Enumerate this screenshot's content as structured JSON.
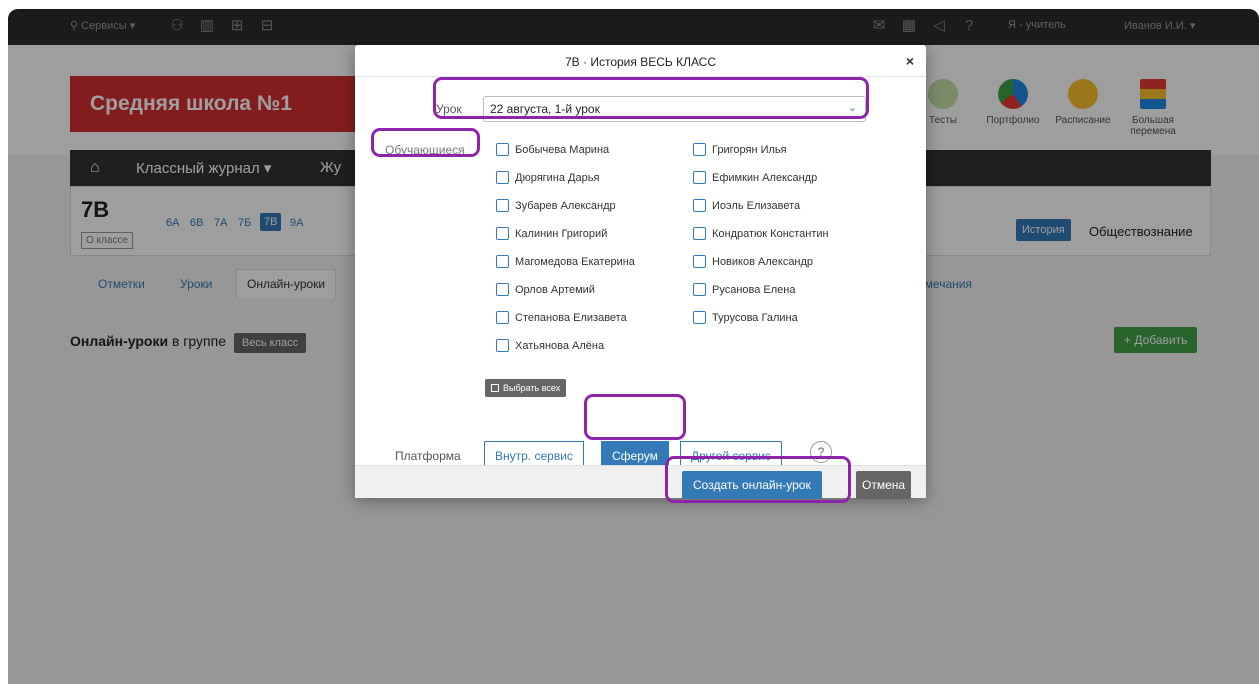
{
  "topbar": {
    "services": "Сервисы",
    "user_role": "Я - учитель",
    "user_name": "Иванов И.И."
  },
  "header": {
    "school_name": "Средняя школа №1",
    "icons": [
      {
        "label": "Тесты",
        "color": "#7cb342"
      },
      {
        "label": "Портфолио",
        "color": "#1e88e5"
      },
      {
        "label": "Расписание",
        "color": "#fbc02d"
      },
      {
        "label": "Большая перемена",
        "color": "#e53935"
      }
    ]
  },
  "journal": {
    "title": "Классный журнал",
    "title2": "Жу"
  },
  "classrow": {
    "current_class": "7В",
    "about": "О классе",
    "classes": [
      "6А",
      "6В",
      "7А",
      "7Б",
      "7В",
      "9А"
    ],
    "subject_button": "История",
    "subject_other": "Обществознание"
  },
  "tabs": [
    "Отметки",
    "Уроки",
    "Онлайн-уроки",
    "амечания"
  ],
  "online": {
    "title": "Онлайн-уроки",
    "in_group": "в группе",
    "group_badge": "Весь класс",
    "add_button": "+ Добавить"
  },
  "modal": {
    "title": "7В · История ВЕСЬ КЛАСС",
    "close": "×",
    "lesson_label": "Урок",
    "lesson_value": "22 августа, 1-й урок",
    "students_label": "Обучающиеся",
    "students_left": [
      "Бобычева Марина",
      "Дюрягина Дарья",
      "Зубарев Александр",
      "Калинин Григорий",
      "Магомедова Екатерина",
      "Орлов Артемий",
      "Степанова Елизавета",
      "Хатьянова Алёна"
    ],
    "students_right": [
      "Григорян Илья",
      "Ефимкин Александр",
      "Иоэль Елизавета",
      "Кондратюк Константин",
      "Новиков Александр",
      "Русанова Елена",
      "Турусова Галина"
    ],
    "select_all": "Выбрать всех",
    "platform_label": "Платформа",
    "platforms": [
      "Внутр. сервис",
      "Сферум",
      "Другой сервис"
    ],
    "platform_selected": "Сферум",
    "help": "?",
    "create_button": "Создать онлайн-урок",
    "cancel_button": "Отмена"
  },
  "colors": {
    "highlight": "#8e24aa",
    "primary": "#337ab7",
    "school_red": "#d32f2f",
    "add_green": "#43a047"
  }
}
